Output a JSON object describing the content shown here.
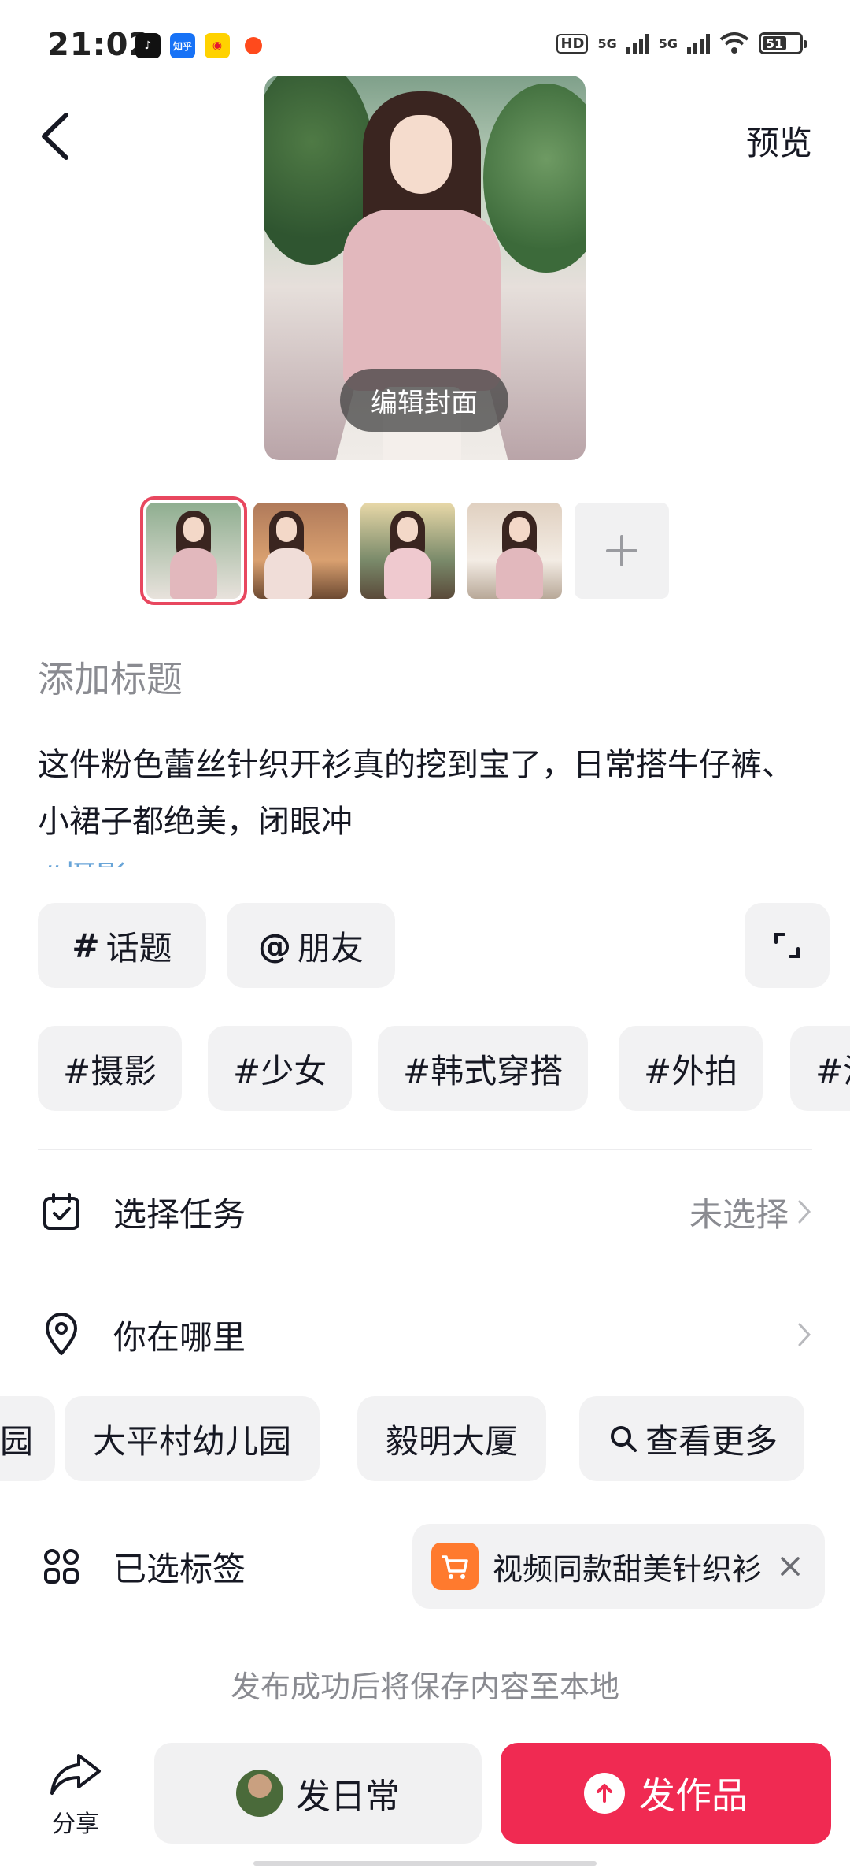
{
  "status_bar": {
    "time": "21:02",
    "apps": [
      "douyin-icon",
      "zhihu-icon",
      "weibo-icon",
      "taobao-icon"
    ],
    "zhihu_label": "知乎",
    "hd_label": "HD",
    "net1": "5G",
    "net2": "5G",
    "battery": "51"
  },
  "header": {
    "preview_label": "预览",
    "edit_cover_label": "编辑封面"
  },
  "thumbnails": {
    "count": 4,
    "selected_index": 0
  },
  "compose": {
    "title_placeholder": "添加标题",
    "body": "这件粉色蕾丝针织开衫真的挖到宝了，日常搭牛仔裤、小裙子都绝美，闭眼冲"
  },
  "insert_buttons": {
    "topic": "话题",
    "topic_symbol": "#",
    "friend": "朋友",
    "friend_symbol": "@"
  },
  "suggested_tags": [
    "#摄影",
    "#少女",
    "#韩式穿搭",
    "#外拍",
    "#温"
  ],
  "task_row": {
    "label": "选择任务",
    "value": "未选择"
  },
  "location_row": {
    "label": "你在哪里"
  },
  "locations": [
    "园",
    "大平村幼儿园",
    "毅明大厦"
  ],
  "see_more": "查看更多",
  "tags_row": {
    "label": "已选标签",
    "product": "视频同款甜美针织衫"
  },
  "save_note": "发布成功后将保存内容至本地",
  "bottom_bar": {
    "share": "分享",
    "daily": "发日常",
    "publish": "发作品"
  },
  "colors": {
    "accent": "#f02a52",
    "selected_border": "#e8475f",
    "cart": "#ff7a2e"
  }
}
